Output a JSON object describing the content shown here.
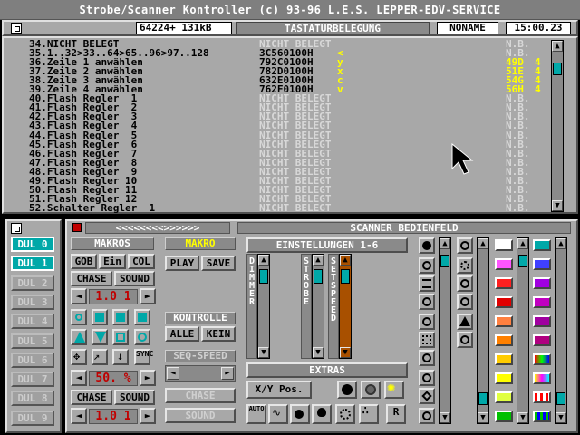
{
  "window": {
    "title": "Strobe/Scanner Kontroller (c) 93-96 L.E.S. LEPPER-EDV-SERVICE"
  },
  "status": {
    "memory": "64224+ 131kB",
    "mode": "TASTATURBELEGUNG",
    "file": "NONAME",
    "time": "15:00.23"
  },
  "keylist": {
    "rows": [
      {
        "name": "34.NICHT BELEGT",
        "code": "NICHT BELEGT",
        "code_dim": true,
        "key": "",
        "nb": "N.B.",
        "nb_hl": false,
        "f": ""
      },
      {
        "name": "35.1..32>33..64>65..96>97..128",
        "code": "3C560100H",
        "code_dim": false,
        "key": "<",
        "nb": "N.B.",
        "nb_hl": false,
        "f": ""
      },
      {
        "name": "36.Zeile 1 anwählen",
        "code": "792C0100H",
        "code_dim": false,
        "key": "y",
        "nb": "49D",
        "nb_hl": true,
        "f": "4"
      },
      {
        "name": "37.Zeile 2 anwählen",
        "code": "782D0100H",
        "code_dim": false,
        "key": "x",
        "nb": "51E",
        "nb_hl": true,
        "f": "4"
      },
      {
        "name": "38.Zeile 3 anwählen",
        "code": "632E0100H",
        "code_dim": false,
        "key": "c",
        "nb": "54G",
        "nb_hl": true,
        "f": "4"
      },
      {
        "name": "39.Zeile 4 anwählen",
        "code": "762F0100H",
        "code_dim": false,
        "key": "v",
        "nb": "56H",
        "nb_hl": true,
        "f": "4"
      },
      {
        "name": "40.Flash Regler  1",
        "code": "NICHT BELEGT",
        "code_dim": true,
        "key": "",
        "nb": "N.B.",
        "nb_hl": false,
        "f": ""
      },
      {
        "name": "41.Flash Regler  2",
        "code": "NICHT BELEGT",
        "code_dim": true,
        "key": "",
        "nb": "N.B.",
        "nb_hl": false,
        "f": ""
      },
      {
        "name": "42.Flash Regler  3",
        "code": "NICHT BELEGT",
        "code_dim": true,
        "key": "",
        "nb": "N.B.",
        "nb_hl": false,
        "f": ""
      },
      {
        "name": "43.Flash Regler  4",
        "code": "NICHT BELEGT",
        "code_dim": true,
        "key": "",
        "nb": "N.B.",
        "nb_hl": false,
        "f": ""
      },
      {
        "name": "44.Flash Regler  5",
        "code": "NICHT BELEGT",
        "code_dim": true,
        "key": "",
        "nb": "N.B.",
        "nb_hl": false,
        "f": ""
      },
      {
        "name": "45.Flash Regler  6",
        "code": "NICHT BELEGT",
        "code_dim": true,
        "key": "",
        "nb": "N.B.",
        "nb_hl": false,
        "f": ""
      },
      {
        "name": "46.Flash Regler  7",
        "code": "NICHT BELEGT",
        "code_dim": true,
        "key": "",
        "nb": "N.B.",
        "nb_hl": false,
        "f": ""
      },
      {
        "name": "47.Flash Regler  8",
        "code": "NICHT BELEGT",
        "code_dim": true,
        "key": "",
        "nb": "N.B.",
        "nb_hl": false,
        "f": ""
      },
      {
        "name": "48.Flash Regler  9",
        "code": "NICHT BELEGT",
        "code_dim": true,
        "key": "",
        "nb": "N.B.",
        "nb_hl": false,
        "f": ""
      },
      {
        "name": "49.Flash Regler 10",
        "code": "NICHT BELEGT",
        "code_dim": true,
        "key": "",
        "nb": "N.B.",
        "nb_hl": false,
        "f": ""
      },
      {
        "name": "50.Flash Regler 11",
        "code": "NICHT BELEGT",
        "code_dim": true,
        "key": "",
        "nb": "N.B.",
        "nb_hl": false,
        "f": ""
      },
      {
        "name": "51.Flash Regler 12",
        "code": "NICHT BELEGT",
        "code_dim": true,
        "key": "",
        "nb": "N.B.",
        "nb_hl": false,
        "f": ""
      },
      {
        "name": "52.Schalter Regler  1",
        "code": "NICHT BELEGT",
        "code_dim": true,
        "key": "",
        "nb": "N.B.",
        "nb_hl": false,
        "f": ""
      }
    ]
  },
  "dul": {
    "items": [
      "DUL 0",
      "DUL 1",
      "DUL 2",
      "DUL 3",
      "DUL 4",
      "DUL 5",
      "DUL 6",
      "DUL 7",
      "DUL 8",
      "DUL 9"
    ],
    "active": [
      0,
      1
    ]
  },
  "scanner": {
    "nav": "<<<<<<<<>>>>>>",
    "title": "SCANNER BEDIENFELD",
    "makros_label": "MAKROS",
    "makro_label": "MAKRO",
    "gob": "GOB",
    "ein": "Ein",
    "col": "COL",
    "chase": "CHASE",
    "sound": "SOUND",
    "play": "PLAY",
    "save": "SAVE",
    "value1": "1.0 1",
    "kontrolle": "KONTROLLE",
    "alle": "ALLE",
    "kein": "KEIN",
    "seq_speed": "SEQ-SPEED",
    "sync": "SYNC",
    "value2": "50. %",
    "chase2": "CHASE",
    "sound2": "SOUND",
    "value3": "1.0 1",
    "chase_dis": "CHASE",
    "sound_dis": "SOUND",
    "einstellungen": "EINSTELLUNGEN 1-6",
    "dimmer": "DIMMER",
    "strobe": "STROBE",
    "set_speed": "SET SPEED",
    "extras": "EXTRAS",
    "xy_pos": "X/Y Pos.",
    "auto": "AUTO",
    "r_label": "R"
  },
  "colors": {
    "accent_cyan": "#00a8a8",
    "value_red": "#c00000",
    "highlight_yellow": "#ffff00",
    "panel_gray": "#a8a8a8"
  }
}
